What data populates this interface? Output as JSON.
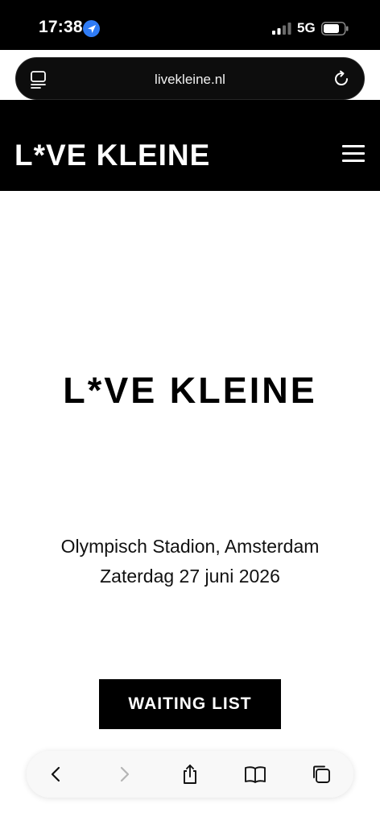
{
  "status": {
    "time": "17:38",
    "network": "5G"
  },
  "browser": {
    "url": "livekleine.nl"
  },
  "site": {
    "logo": "L*VE KLEINE",
    "hero_logo": "L*VE KLEINE",
    "venue": "Olympisch Stadion, Amsterdam",
    "date": "Zaterdag 27 juni 2026",
    "cta_label": "WAITING LIST"
  },
  "colors": {
    "header_bg": "#000000",
    "page_bg": "#ffffff",
    "location_accent": "#2f7cf6"
  },
  "icons": {
    "status": [
      "location-arrow-icon",
      "signal-icon",
      "battery-icon"
    ],
    "address_bar": [
      "tab-overview-icon",
      "reload-icon"
    ],
    "toolbar": [
      "back-icon",
      "forward-icon",
      "share-icon",
      "bookmarks-icon",
      "tabs-icon"
    ]
  }
}
